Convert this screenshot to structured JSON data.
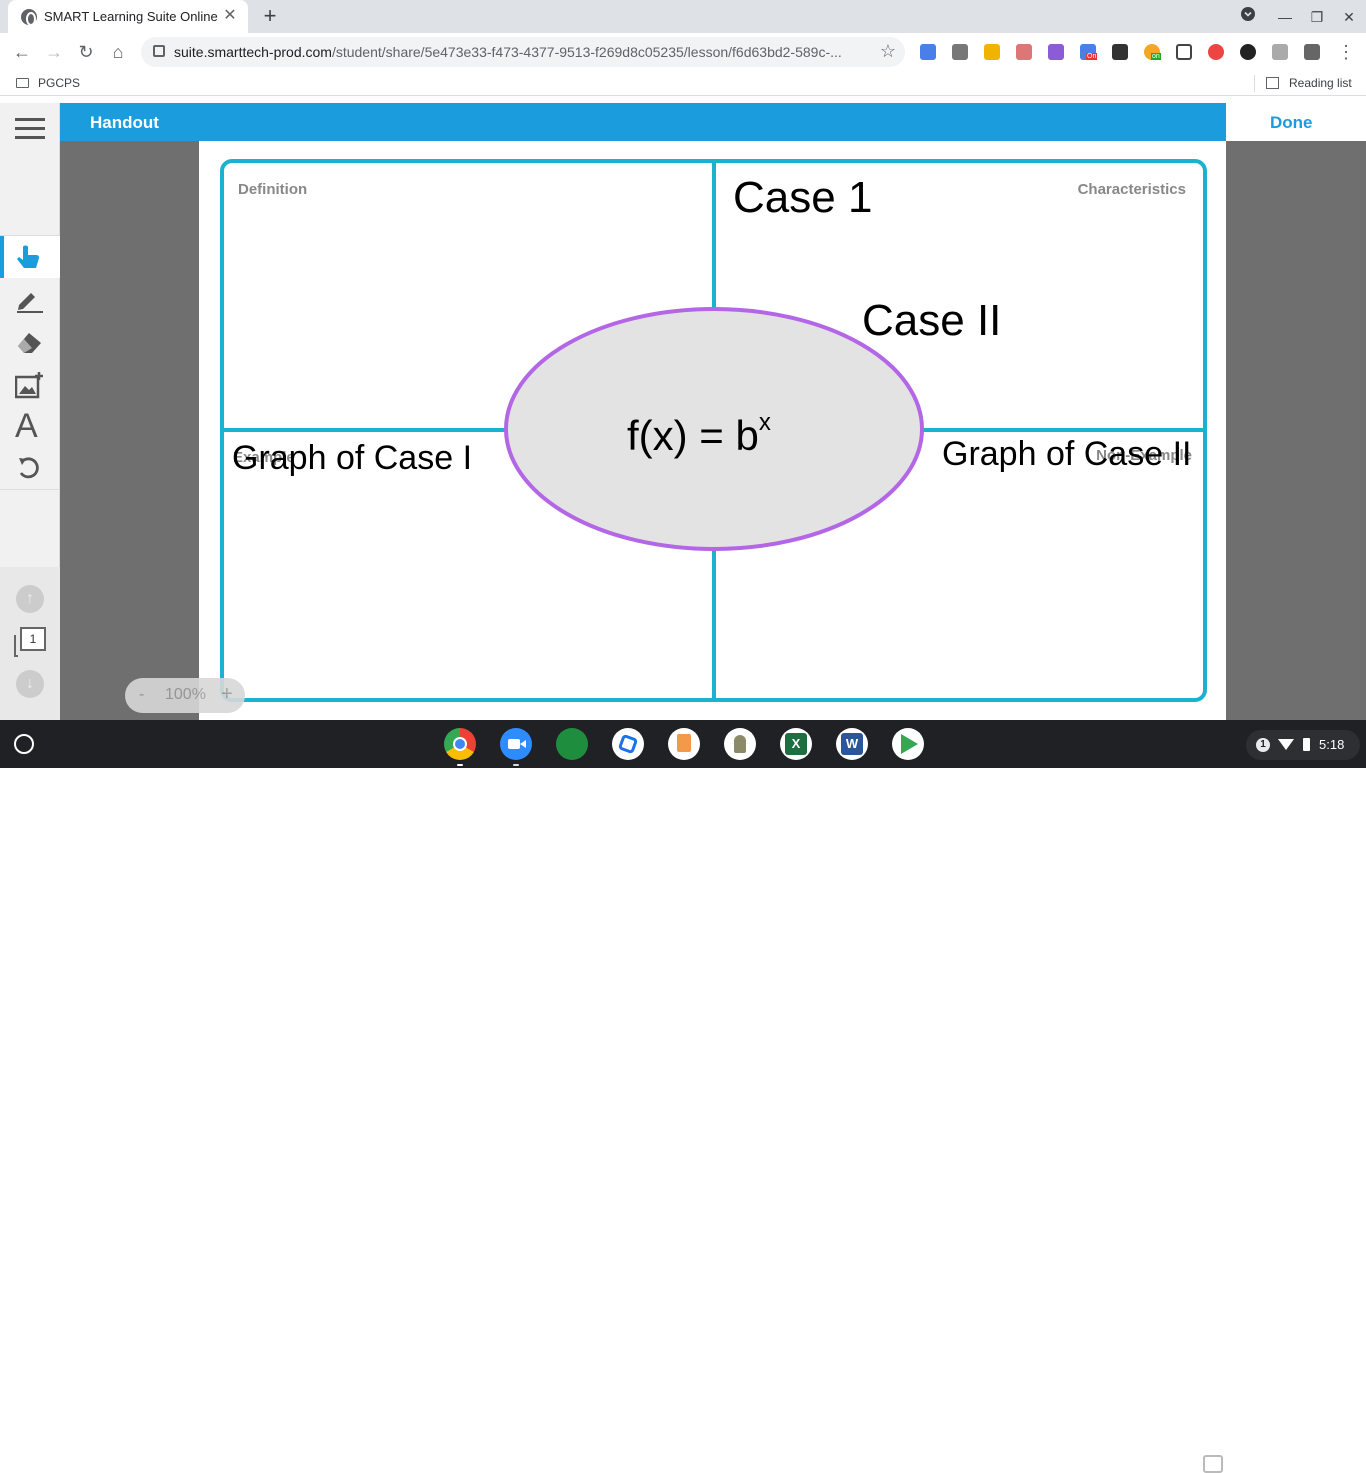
{
  "browser": {
    "tab_title": "SMART Learning Suite Online",
    "new_tab_label": "+",
    "url_host": "suite.smarttech-prod.com",
    "url_path": "/student/share/5e473e33-f473-4377-9513-f269d8c05235/lesson/f6d63bd2-589c-...",
    "bookmarks": [
      "PGCPS"
    ],
    "reading_list_label": "Reading list",
    "extension_badges": {
      "on_red": "On",
      "on_green": "on"
    }
  },
  "app": {
    "header_title": "Handout",
    "done_label": "Done",
    "left_toolbar": {
      "tools": [
        "menu-icon",
        "select-hand-icon",
        "pen-icon",
        "eraser-icon",
        "add-image-icon",
        "text-icon",
        "undo-icon"
      ],
      "page_number": "1"
    },
    "zoom": {
      "minus": "-",
      "value": "100%",
      "plus": "+"
    },
    "frayer": {
      "labels": {
        "top_left": "Definition",
        "top_right": "Characteristics",
        "bottom_left": "Example",
        "bottom_right": "Non-Example"
      },
      "handwritten": {
        "case1": "Case 1",
        "case2": "Case II",
        "graph1": "Graph of Case I",
        "graph2": "Graph of Case II"
      },
      "center_base": "f(x) = b",
      "center_exponent": "x",
      "colors": {
        "border": "#1ab2cf",
        "ellipse_stroke": "#b366e6",
        "ellipse_fill": "#e3e3e3"
      }
    }
  },
  "shelf": {
    "apps": [
      "chrome-icon",
      "zoom-icon",
      "classroom-icon",
      "screencast-icon",
      "easybib-icon",
      "reading-icon",
      "excel-icon",
      "word-icon",
      "play-store-icon"
    ],
    "tray": {
      "notification_count": "1",
      "time": "5:18"
    }
  }
}
